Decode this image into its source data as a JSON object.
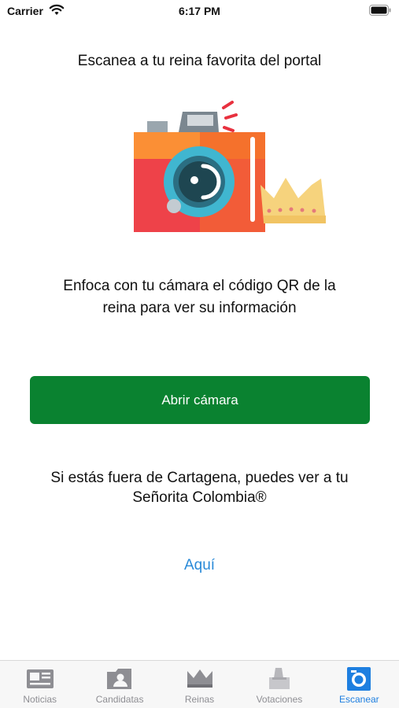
{
  "status_bar": {
    "carrier": "Carrier",
    "time": "6:17 PM"
  },
  "headline": "Escanea a tu reina favorita del portal",
  "instructions": "Enfoca con tu cámara el código QR de la reina para ver su información",
  "open_camera_button": "Abrir cámara",
  "outside_text": "Si estás fuera de Cartagena, puedes ver a tu Señorita Colombia®",
  "here_link": "Aquí",
  "tabs": [
    {
      "label": "Noticias",
      "icon": "newspaper-icon",
      "active": false
    },
    {
      "label": "Candidatas",
      "icon": "candidates-folder-icon",
      "active": false
    },
    {
      "label": "Reinas",
      "icon": "crown-icon",
      "active": false
    },
    {
      "label": "Votaciones",
      "icon": "ballot-box-icon",
      "active": false
    },
    {
      "label": "Escanear",
      "icon": "camera-icon",
      "active": true
    }
  ],
  "colors": {
    "accent_green": "#0a8230",
    "link_blue": "#2a8ad8",
    "active_tab": "#1e7fe0"
  }
}
